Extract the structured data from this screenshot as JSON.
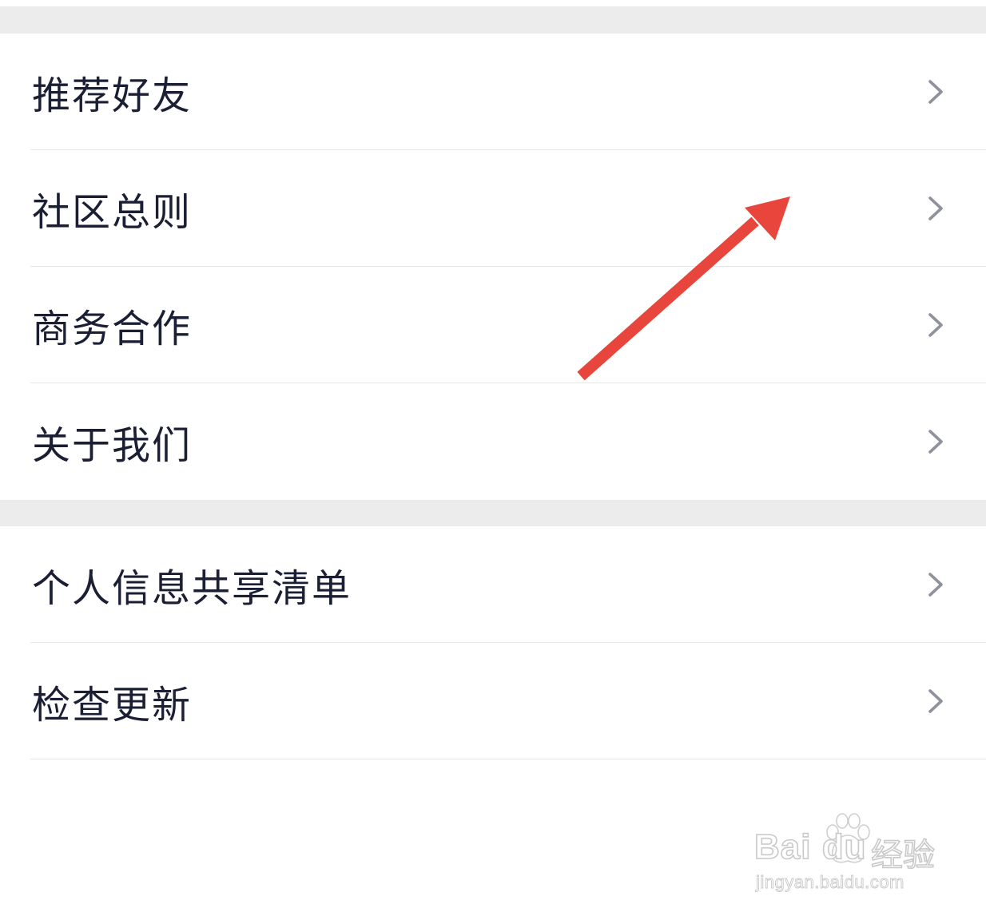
{
  "group1": {
    "items": [
      {
        "label": "推荐好友"
      },
      {
        "label": "社区总则"
      },
      {
        "label": "商务合作"
      },
      {
        "label": "关于我们"
      }
    ]
  },
  "group2": {
    "items": [
      {
        "label": "个人信息共享清单"
      },
      {
        "label": "检查更新"
      }
    ]
  },
  "icons": {
    "row_chevron": "chevron-right-icon",
    "annotation": "red-arrow-annotation"
  },
  "colors": {
    "section_gap": "#ececec",
    "text": "#1b1f33",
    "chevron": "#8e929a",
    "divider": "#e6e6e6",
    "annotation_arrow": "#e8453c"
  },
  "watermark": {
    "brand": "Bai du",
    "product": "经验",
    "url": "jingyan.baidu.com"
  }
}
